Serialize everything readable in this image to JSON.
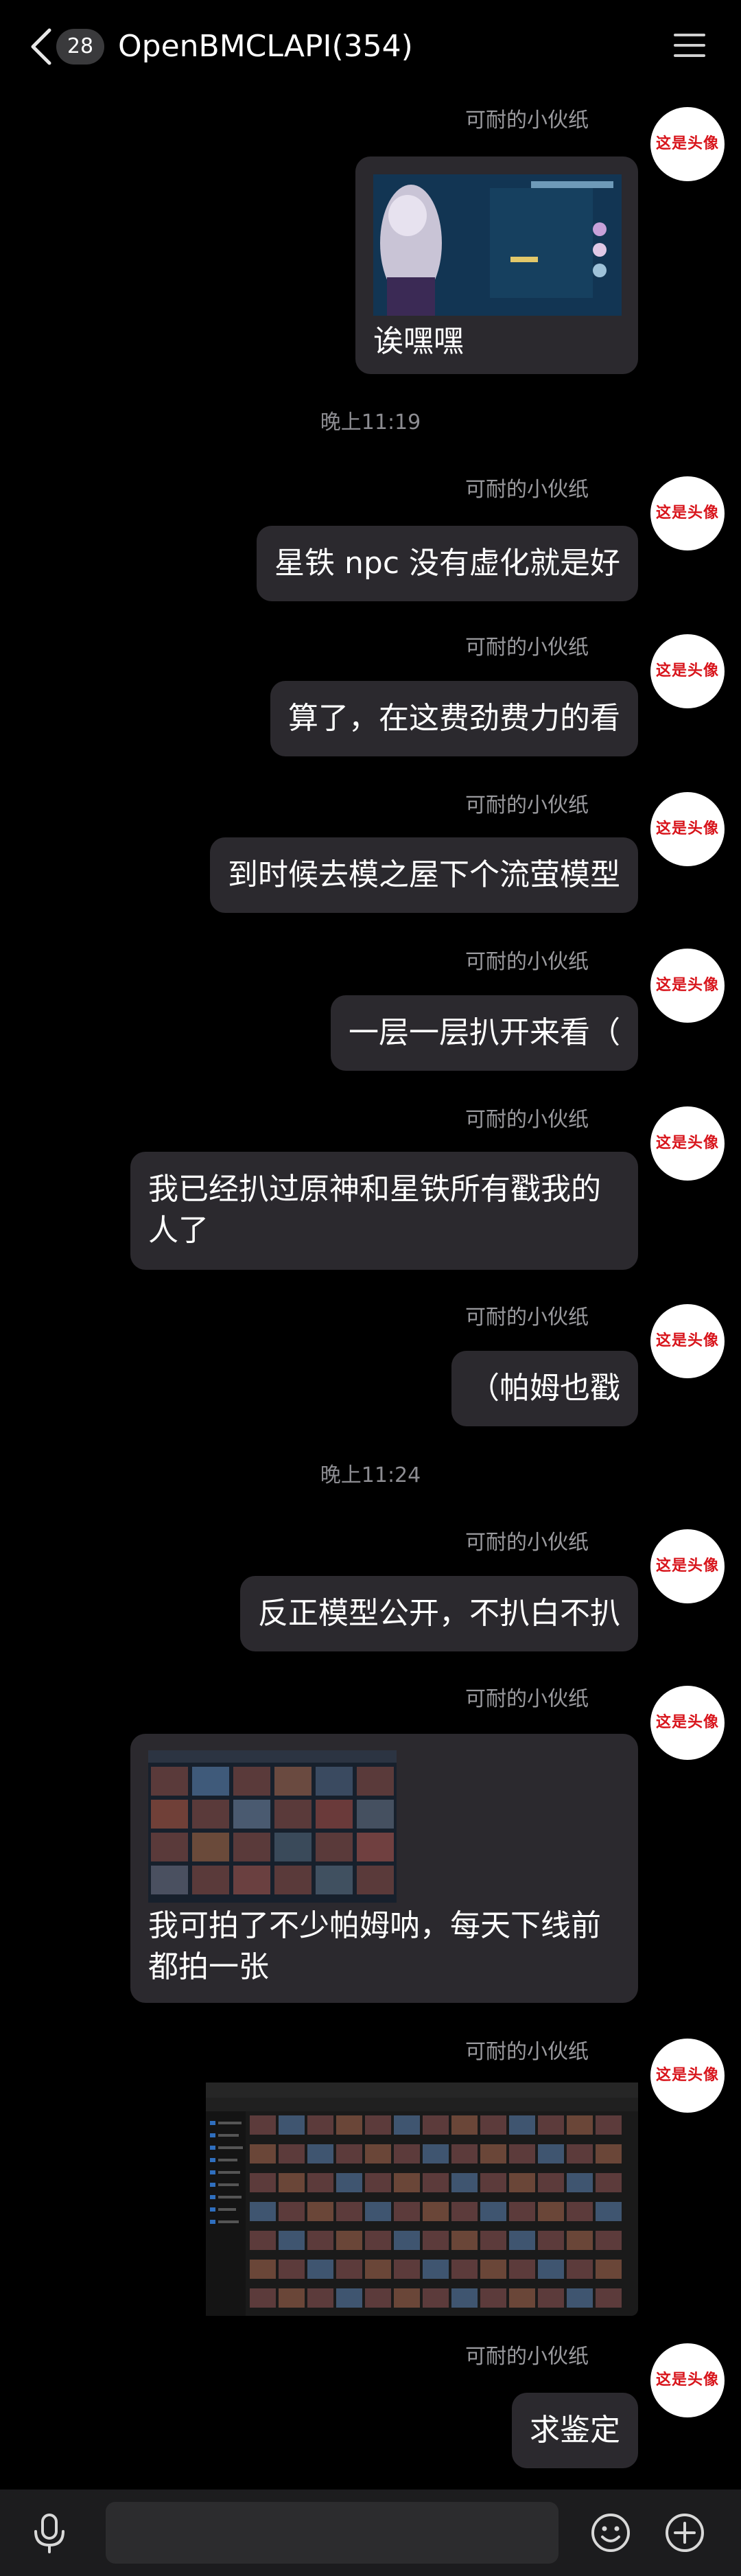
{
  "header": {
    "unread_count": "28",
    "title": "OpenBMCLAPI(354)",
    "back_icon": "chevron-left-icon",
    "menu_icon": "hamburger-menu-icon"
  },
  "avatar_text": "这是头像",
  "sender_name": "可耐的小伙纸",
  "timestamps": [
    "晚上11:19",
    "晚上11:24"
  ],
  "messages": [
    {
      "type": "image-text",
      "text": "诶嘿嘿",
      "image": "game-screenshot"
    },
    {
      "type": "text",
      "text": "星铁 npc 没有虚化就是好"
    },
    {
      "type": "text",
      "text": "算了，在这费劲费力的看"
    },
    {
      "type": "text",
      "text": "到时候去模之屋下个流萤模型"
    },
    {
      "type": "text",
      "text": "一层一层扒开来看（"
    },
    {
      "type": "text",
      "text": "我已经扒过原神和星铁所有戳我的\n人了"
    },
    {
      "type": "text",
      "text": "（帕姆也戳"
    },
    {
      "type": "text",
      "text": "反正模型公开，不扒白不扒"
    },
    {
      "type": "image-text",
      "text": "我可拍了不少帕姆呐，每天下线前\n都拍一张",
      "image": "photo-gallery-screenshot"
    },
    {
      "type": "image",
      "image": "file-explorer-thumbnails-screenshot"
    },
    {
      "type": "text",
      "text": "求鉴定"
    }
  ],
  "input_bar": {
    "voice_icon": "microphone-icon",
    "emoji_icon": "emoji-icon",
    "add_icon": "plus-circle-icon"
  },
  "colors": {
    "background": "#000000",
    "bubble": "#2b292e",
    "sender": "#9a9a9e",
    "avatar_text": "#d8141b",
    "input_bar": "#1c1c1e"
  }
}
